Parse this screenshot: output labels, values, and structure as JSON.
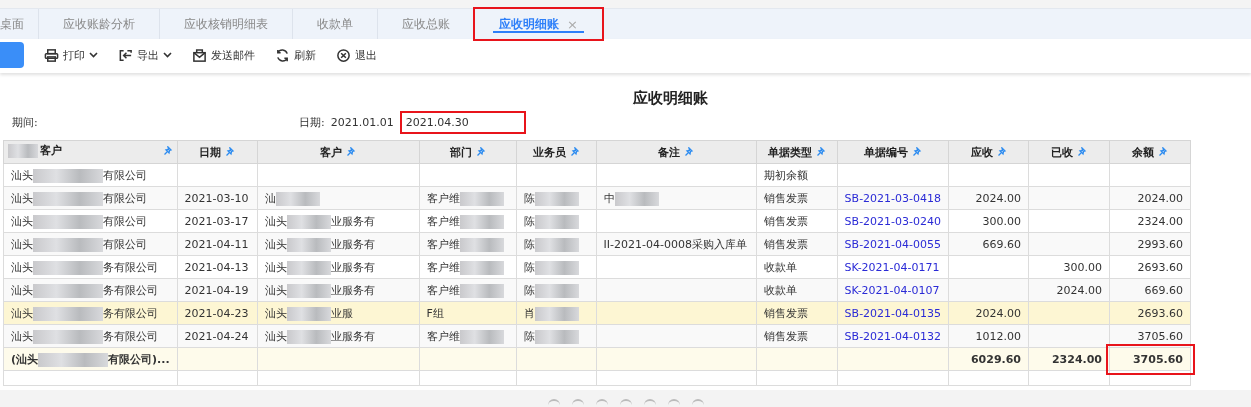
{
  "tabs": [
    {
      "label": "桌面",
      "selected": false,
      "highlighted": false
    },
    {
      "label": "应收账龄分析",
      "selected": false,
      "highlighted": false
    },
    {
      "label": "应收核销明细表",
      "selected": false,
      "highlighted": false
    },
    {
      "label": "收款单",
      "selected": false,
      "highlighted": false
    },
    {
      "label": "应收总账",
      "selected": false,
      "highlighted": false
    },
    {
      "label": "应收明细账",
      "selected": true,
      "close": "×",
      "highlighted": true
    }
  ],
  "toolbar": [
    {
      "kind": "primary"
    },
    {
      "kind": "print",
      "label": "打印",
      "dropdown": true
    },
    {
      "kind": "export",
      "label": "导出",
      "dropdown": true
    },
    {
      "kind": "mail",
      "label": "发送邮件",
      "dropdown": false
    },
    {
      "kind": "refresh",
      "label": "刷新",
      "dropdown": false
    },
    {
      "kind": "exit",
      "label": "退出",
      "dropdown": false
    }
  ],
  "report": {
    "title": "应收明细账",
    "period_label": "期间:",
    "date_label": "日期:",
    "date_from": "2021.01.01",
    "date_to": "2021.04.30",
    "date_to_highlighted": true
  },
  "table": {
    "columns": [
      {
        "label": "客户",
        "blur_before": true,
        "kind": "text"
      },
      {
        "label": "日期",
        "kind": "text"
      },
      {
        "label": "客户",
        "kind": "text"
      },
      {
        "label": "部门",
        "kind": "text"
      },
      {
        "label": "业务员",
        "kind": "text"
      },
      {
        "label": "备注",
        "kind": "text"
      },
      {
        "label": "单据类型",
        "kind": "text"
      },
      {
        "label": "单据编号",
        "kind": "text"
      },
      {
        "label": "应收",
        "kind": "amount"
      },
      {
        "label": "已收",
        "kind": "amount"
      },
      {
        "label": "余额",
        "kind": "amount"
      }
    ],
    "rows": [
      {
        "selected": false,
        "cells": [
          {
            "before": "汕头",
            "after": "有限公司"
          },
          null,
          null,
          null,
          null,
          null,
          "期初余额",
          null,
          null,
          null,
          null
        ]
      },
      {
        "selected": false,
        "cells": [
          {
            "before": "汕头",
            "after": "有限公司"
          },
          "2021-03-10",
          {
            "before": "汕"
          },
          {
            "before": "客户维"
          },
          {
            "before": "陈"
          },
          {
            "before": "中"
          },
          "销售发票",
          {
            "link": "SB-2021-03-0418"
          },
          "2024.00",
          null,
          "2024.00"
        ]
      },
      {
        "selected": false,
        "cells": [
          {
            "before": "汕头",
            "after": "有限公司"
          },
          "2021-03-17",
          {
            "before": "汕头",
            "after": "业服务有"
          },
          {
            "before": "客户维"
          },
          {
            "before": "陈"
          },
          null,
          "销售发票",
          {
            "link": "SB-2021-03-0240"
          },
          "300.00",
          null,
          "2324.00"
        ]
      },
      {
        "selected": false,
        "cells": [
          {
            "before": "汕头",
            "after": "有限公司"
          },
          "2021-04-11",
          {
            "before": "汕头",
            "after": "业服务有"
          },
          {
            "before": "客户维"
          },
          {
            "before": "陈"
          },
          "II-2021-04-0008采购入库单",
          "销售发票",
          {
            "link": "SB-2021-04-0055"
          },
          "669.60",
          null,
          "2993.60"
        ]
      },
      {
        "selected": false,
        "cells": [
          {
            "before": "汕头",
            "after": "务有限公司"
          },
          "2021-04-13",
          {
            "before": "汕头",
            "after": "业服务有"
          },
          {
            "before": "客户维"
          },
          {
            "before": "陈"
          },
          null,
          "收款单",
          {
            "link": "SK-2021-04-0171"
          },
          null,
          "300.00",
          "2693.60"
        ]
      },
      {
        "selected": false,
        "cells": [
          {
            "before": "汕头",
            "after": "务有限公司"
          },
          "2021-04-19",
          {
            "before": "汕头",
            "after": "业服务有"
          },
          {
            "before": "客户维"
          },
          {
            "before": "陈"
          },
          null,
          "收款单",
          {
            "link": "SK-2021-04-0107"
          },
          null,
          "2024.00",
          "669.60"
        ]
      },
      {
        "selected": true,
        "cells": [
          {
            "before": "汕头",
            "after": "务有限公司"
          },
          "2021-04-23",
          {
            "before": "汕头",
            "after": "业服"
          },
          "F组",
          {
            "before": "肖"
          },
          null,
          "销售发票",
          {
            "link": "SB-2021-04-0135"
          },
          "2024.00",
          null,
          "2693.60"
        ]
      },
      {
        "selected": false,
        "cells": [
          {
            "before": "汕头",
            "after": "务有限公司"
          },
          "2021-04-24",
          {
            "before": "汕头",
            "after": "业服务有"
          },
          {
            "before": "客户维"
          },
          {
            "before": "陈"
          },
          null,
          "销售发票",
          {
            "link": "SB-2021-04-0132"
          },
          "1012.00",
          null,
          "3705.60"
        ]
      }
    ],
    "total": {
      "cells": [
        {
          "before": "(汕头",
          "after": "有限公司)..."
        },
        null,
        null,
        null,
        null,
        null,
        null,
        null,
        "6029.60",
        "2324.00",
        "3705.60"
      ],
      "balance_highlighted": true
    }
  }
}
